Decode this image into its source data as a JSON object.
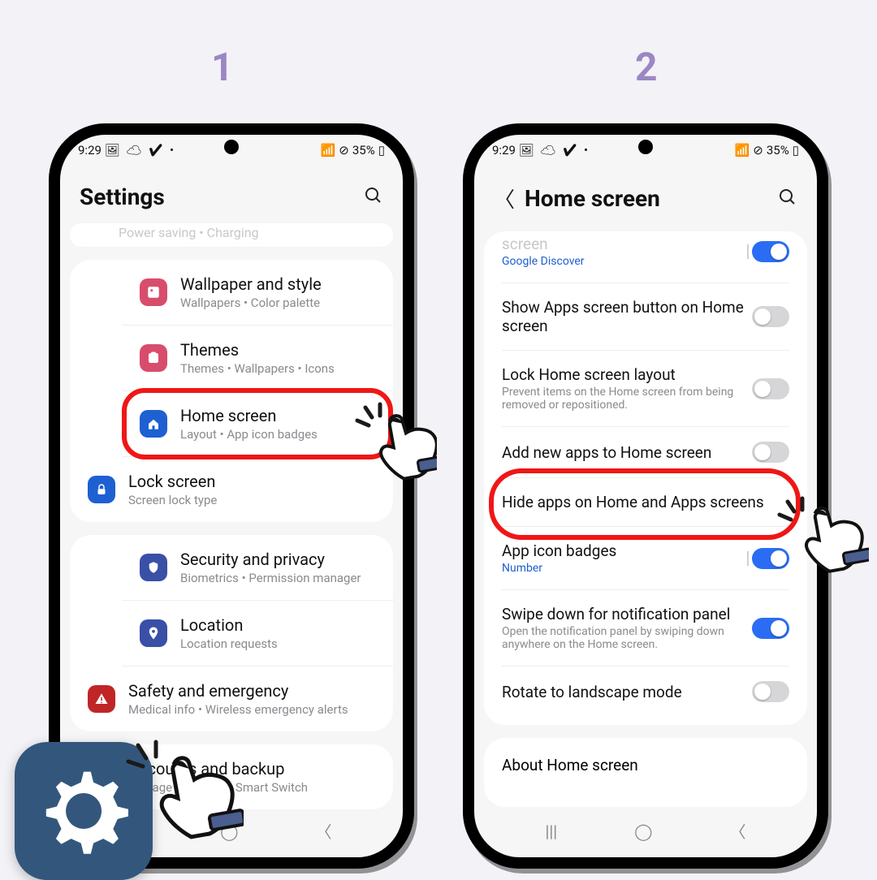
{
  "steps": {
    "one": "1",
    "two": "2"
  },
  "status": {
    "time": "9:29",
    "icons_left": "🖼 ☁ ✔ •",
    "battery": "35%",
    "sig": "📶 ⊘"
  },
  "phone1": {
    "title": "Settings",
    "faded": "Power saving  •  Charging",
    "items": [
      {
        "title": "Wallpaper and style",
        "sub": "Wallpapers  •  Color palette",
        "color": "#d84d6c",
        "icon": "wallpaper"
      },
      {
        "title": "Themes",
        "sub": "Themes  •  Wallpapers  •  Icons",
        "color": "#d84d6c",
        "icon": "themes"
      },
      {
        "title": "Home screen",
        "sub": "Layout  •  App icon badges",
        "color": "#1e5fd2",
        "icon": "home",
        "hl": true
      },
      {
        "title": "Lock screen",
        "sub": "Screen lock type",
        "color": "#1e5fd2",
        "icon": "lock"
      }
    ],
    "items2": [
      {
        "title": "Security and privacy",
        "sub": "Biometrics  •  Permission manager",
        "color": "#3a4fa6",
        "icon": "shield"
      },
      {
        "title": "Location",
        "sub": "Location requests",
        "color": "#3a4fa6",
        "icon": "pin"
      },
      {
        "title": "Safety and emergency",
        "sub": "Medical info  •  Wireless emergency alerts",
        "color": "#c02626",
        "icon": "alert"
      }
    ],
    "items3": [
      {
        "title": "Accounts and backup",
        "sub": "Manage accounts  •  Smart Switch",
        "color": "#3a4fa6",
        "icon": "sync"
      }
    ]
  },
  "phone2": {
    "title": "Home screen",
    "top": {
      "title": "Add media page to Home screen",
      "short": "screen",
      "link": "Google Discover",
      "on": true
    },
    "options": [
      {
        "t": "Show Apps screen button on Home screen",
        "on": false
      },
      {
        "t": "Lock Home screen layout",
        "s": "Prevent items on the Home screen from being removed or repositioned.",
        "on": false
      },
      {
        "t": "Add new apps to Home screen",
        "on": false
      },
      {
        "t": "Hide apps on Home and Apps screens",
        "hl": true
      },
      {
        "t": "App icon badges",
        "link": "Number",
        "on": true,
        "bar": true
      },
      {
        "t": "Swipe down for notification panel",
        "s": "Open the notification panel by swiping down anywhere on the Home screen.",
        "on": true
      },
      {
        "t": "Rotate to landscape mode",
        "on": false
      }
    ],
    "about": "About Home screen"
  }
}
